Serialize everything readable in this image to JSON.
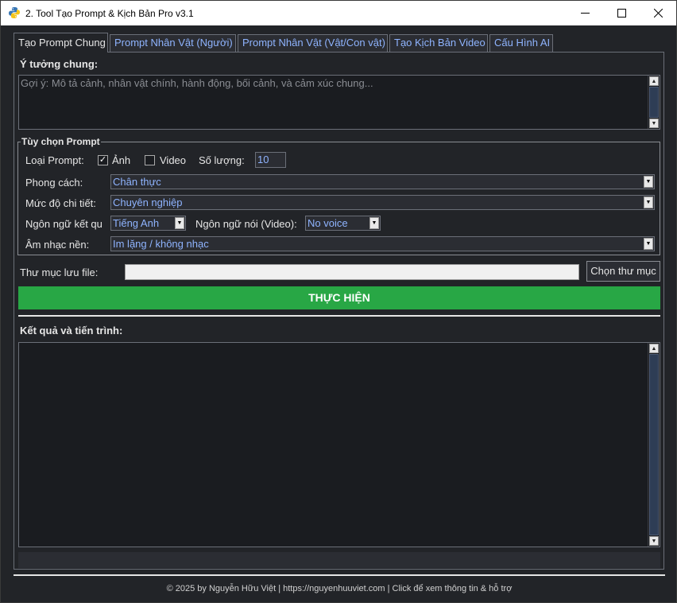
{
  "window": {
    "title": "2. Tool Tạo Prompt & Kịch Bản Pro v3.1",
    "controls": {
      "minimize": "—",
      "maximize": "☐",
      "close": "✕"
    }
  },
  "tabs": [
    {
      "label": "Tạo Prompt Chung",
      "active": true
    },
    {
      "label": "Prompt Nhân Vật (Người)",
      "active": false
    },
    {
      "label": "Prompt Nhân Vật (Vật/Con vật)",
      "active": false
    },
    {
      "label": "Tạo Kịch Bản Video",
      "active": false
    },
    {
      "label": "Cấu Hình AI",
      "active": false
    }
  ],
  "idea": {
    "label": "Ý tưởng chung:",
    "placeholder": "Gợi ý: Mô tả cảnh, nhân vật chính, hành động, bối cảnh, và cảm xúc chung..."
  },
  "options": {
    "legend": "Tùy chọn Prompt",
    "prompt_type_label": "Loại Prompt:",
    "image_label": "Ảnh",
    "image_checked": true,
    "video_label": "Video",
    "video_checked": false,
    "quantity_label": "Số lượng:",
    "quantity_value": "10",
    "style_label": "Phong cách:",
    "style_value": "Chân thực",
    "detail_label": "Mức độ chi tiết:",
    "detail_value": "Chuyên nghiệp",
    "output_lang_label": "Ngôn ngữ kết qu",
    "output_lang_value": "Tiếng Anh",
    "spoken_lang_label": "Ngôn ngữ nói (Video):",
    "spoken_lang_value": "No voice",
    "music_label": "Âm nhạc nền:",
    "music_value": "Im lặng / không nhạc"
  },
  "folder": {
    "label": "Thư mục lưu file:",
    "value": "",
    "button": "Chọn thư mục"
  },
  "run_button": "THỰC HIỆN",
  "results": {
    "label": "Kết quả và tiến trình:",
    "content": ""
  },
  "progress": 0,
  "footer": "© 2025 by Nguyễn Hữu Việt | https://nguyenhuuviet.com | Click để xem thông tin & hỗ trợ",
  "colors": {
    "background": "#222428",
    "accent_text": "#8fb4ff",
    "run_button": "#28a745",
    "border": "#6b6f78"
  }
}
